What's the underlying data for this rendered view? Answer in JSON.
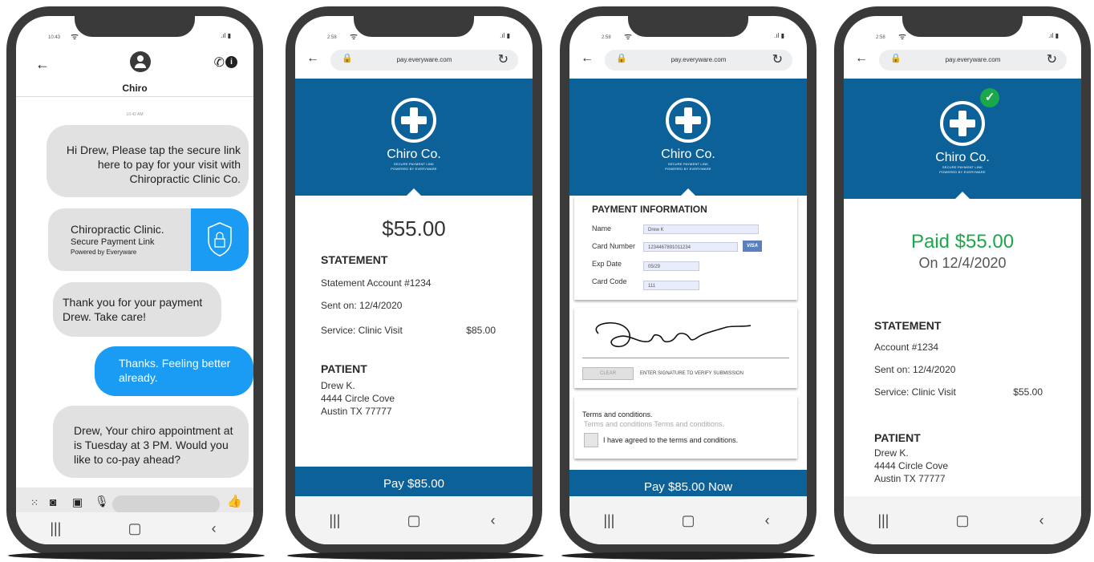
{
  "phone1": {
    "status_time": "10:43",
    "contact_name": "Chiro",
    "timestamp": "10:42 AM",
    "messages": [
      "Hi Drew, Please tap the secure link here to pay for your visit with Chiropractic Clinic Co.",
      "Thank you for your payment Drew. Take care!",
      "Thanks. Feeling better already.",
      "Drew, Your chiro appointment at is Tuesday at 3 PM. Would you like to co-pay ahead?"
    ],
    "link_card": {
      "title": "Chiropractic Clinic.",
      "line1": "Secure Payment Link",
      "line2": "Powered by Everyware"
    }
  },
  "browser": {
    "status_time": "2:58",
    "url": "pay.everyware.com"
  },
  "hero": {
    "brand": "Chiro Co.",
    "sub1": "SECURE PAYMENT LINK",
    "sub2": "POWERED BY EVERYWARE"
  },
  "phone2": {
    "amount": "$55.00",
    "statement_title": "STATEMENT",
    "account": "Statement Account #1234",
    "sent": "Sent on: 12/4/2020",
    "service_label": "Service: Clinic Visit",
    "service_amount": "$85.00",
    "patient_title": "PATIENT",
    "patient_name": "Drew K.",
    "patient_addr1": "4444 Circle Cove",
    "patient_addr2": "Austin TX 77777",
    "pay_button": "Pay $85.00"
  },
  "phone3": {
    "section_title": "PAYMENT INFORMATION",
    "name_label": "Name",
    "name_value": "Drew K",
    "card_label": "Card Number",
    "card_value": "1234467891011234",
    "card_brand": "VISA",
    "exp_label": "Exp Date",
    "exp_value": "05/29",
    "code_label": "Card Code",
    "code_value": "111",
    "clear_button": "CLEAR",
    "sign_hint": "ENTER SIGNATURE TO VERIFY SUBMISSION",
    "terms_title": "Terms and conditions.",
    "terms_text": "Terms and conditions Terms and conditions.",
    "agree_label": "I have agreed to the terms and conditions.",
    "pay_button": "Pay $85.00 Now"
  },
  "phone4": {
    "paid": "Paid $55.00",
    "paid_on": "On 12/4/2020",
    "statement_title": "STATEMENT",
    "account": "Account #1234",
    "sent": "Sent on: 12/4/2020",
    "service_label": "Service: Clinic Visit",
    "service_amount": "$55.00",
    "patient_title": "PATIENT",
    "patient_name": "Drew K.",
    "patient_addr1": "4444 Circle Cove",
    "patient_addr2": "Austin TX 77777"
  },
  "colors": {
    "brand_blue": "#0c6199",
    "bubble_blue": "#1a9cf5",
    "paid_green": "#1aa84a"
  }
}
